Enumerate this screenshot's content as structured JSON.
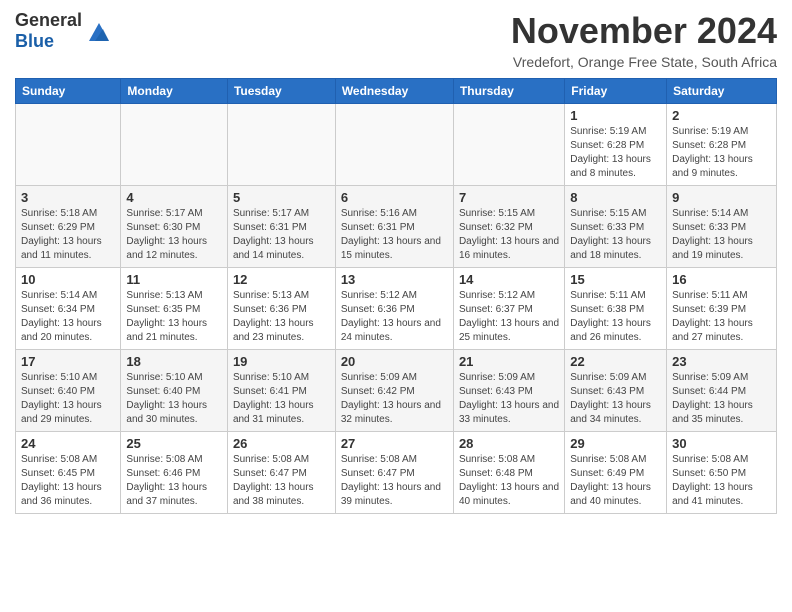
{
  "header": {
    "logo_general": "General",
    "logo_blue": "Blue",
    "month_title": "November 2024",
    "location": "Vredefort, Orange Free State, South Africa"
  },
  "weekdays": [
    "Sunday",
    "Monday",
    "Tuesday",
    "Wednesday",
    "Thursday",
    "Friday",
    "Saturday"
  ],
  "weeks": [
    [
      {
        "day": "",
        "info": ""
      },
      {
        "day": "",
        "info": ""
      },
      {
        "day": "",
        "info": ""
      },
      {
        "day": "",
        "info": ""
      },
      {
        "day": "",
        "info": ""
      },
      {
        "day": "1",
        "info": "Sunrise: 5:19 AM\nSunset: 6:28 PM\nDaylight: 13 hours and 8 minutes."
      },
      {
        "day": "2",
        "info": "Sunrise: 5:19 AM\nSunset: 6:28 PM\nDaylight: 13 hours and 9 minutes."
      }
    ],
    [
      {
        "day": "3",
        "info": "Sunrise: 5:18 AM\nSunset: 6:29 PM\nDaylight: 13 hours and 11 minutes."
      },
      {
        "day": "4",
        "info": "Sunrise: 5:17 AM\nSunset: 6:30 PM\nDaylight: 13 hours and 12 minutes."
      },
      {
        "day": "5",
        "info": "Sunrise: 5:17 AM\nSunset: 6:31 PM\nDaylight: 13 hours and 14 minutes."
      },
      {
        "day": "6",
        "info": "Sunrise: 5:16 AM\nSunset: 6:31 PM\nDaylight: 13 hours and 15 minutes."
      },
      {
        "day": "7",
        "info": "Sunrise: 5:15 AM\nSunset: 6:32 PM\nDaylight: 13 hours and 16 minutes."
      },
      {
        "day": "8",
        "info": "Sunrise: 5:15 AM\nSunset: 6:33 PM\nDaylight: 13 hours and 18 minutes."
      },
      {
        "day": "9",
        "info": "Sunrise: 5:14 AM\nSunset: 6:33 PM\nDaylight: 13 hours and 19 minutes."
      }
    ],
    [
      {
        "day": "10",
        "info": "Sunrise: 5:14 AM\nSunset: 6:34 PM\nDaylight: 13 hours and 20 minutes."
      },
      {
        "day": "11",
        "info": "Sunrise: 5:13 AM\nSunset: 6:35 PM\nDaylight: 13 hours and 21 minutes."
      },
      {
        "day": "12",
        "info": "Sunrise: 5:13 AM\nSunset: 6:36 PM\nDaylight: 13 hours and 23 minutes."
      },
      {
        "day": "13",
        "info": "Sunrise: 5:12 AM\nSunset: 6:36 PM\nDaylight: 13 hours and 24 minutes."
      },
      {
        "day": "14",
        "info": "Sunrise: 5:12 AM\nSunset: 6:37 PM\nDaylight: 13 hours and 25 minutes."
      },
      {
        "day": "15",
        "info": "Sunrise: 5:11 AM\nSunset: 6:38 PM\nDaylight: 13 hours and 26 minutes."
      },
      {
        "day": "16",
        "info": "Sunrise: 5:11 AM\nSunset: 6:39 PM\nDaylight: 13 hours and 27 minutes."
      }
    ],
    [
      {
        "day": "17",
        "info": "Sunrise: 5:10 AM\nSunset: 6:40 PM\nDaylight: 13 hours and 29 minutes."
      },
      {
        "day": "18",
        "info": "Sunrise: 5:10 AM\nSunset: 6:40 PM\nDaylight: 13 hours and 30 minutes."
      },
      {
        "day": "19",
        "info": "Sunrise: 5:10 AM\nSunset: 6:41 PM\nDaylight: 13 hours and 31 minutes."
      },
      {
        "day": "20",
        "info": "Sunrise: 5:09 AM\nSunset: 6:42 PM\nDaylight: 13 hours and 32 minutes."
      },
      {
        "day": "21",
        "info": "Sunrise: 5:09 AM\nSunset: 6:43 PM\nDaylight: 13 hours and 33 minutes."
      },
      {
        "day": "22",
        "info": "Sunrise: 5:09 AM\nSunset: 6:43 PM\nDaylight: 13 hours and 34 minutes."
      },
      {
        "day": "23",
        "info": "Sunrise: 5:09 AM\nSunset: 6:44 PM\nDaylight: 13 hours and 35 minutes."
      }
    ],
    [
      {
        "day": "24",
        "info": "Sunrise: 5:08 AM\nSunset: 6:45 PM\nDaylight: 13 hours and 36 minutes."
      },
      {
        "day": "25",
        "info": "Sunrise: 5:08 AM\nSunset: 6:46 PM\nDaylight: 13 hours and 37 minutes."
      },
      {
        "day": "26",
        "info": "Sunrise: 5:08 AM\nSunset: 6:47 PM\nDaylight: 13 hours and 38 minutes."
      },
      {
        "day": "27",
        "info": "Sunrise: 5:08 AM\nSunset: 6:47 PM\nDaylight: 13 hours and 39 minutes."
      },
      {
        "day": "28",
        "info": "Sunrise: 5:08 AM\nSunset: 6:48 PM\nDaylight: 13 hours and 40 minutes."
      },
      {
        "day": "29",
        "info": "Sunrise: 5:08 AM\nSunset: 6:49 PM\nDaylight: 13 hours and 40 minutes."
      },
      {
        "day": "30",
        "info": "Sunrise: 5:08 AM\nSunset: 6:50 PM\nDaylight: 13 hours and 41 minutes."
      }
    ]
  ]
}
